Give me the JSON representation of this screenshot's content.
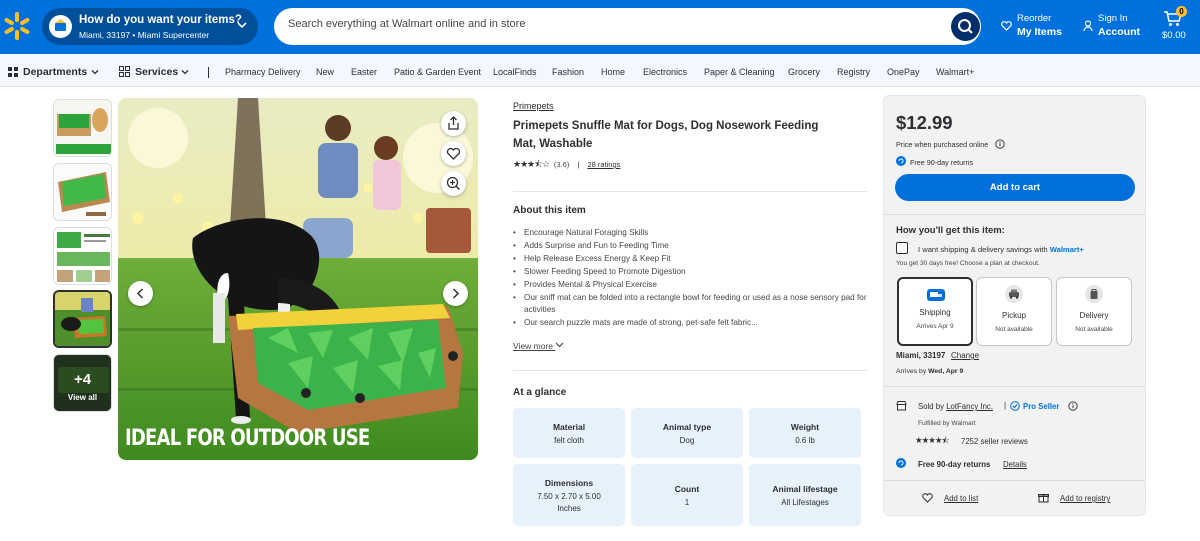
{
  "header": {
    "location_question": "How do you want your items?",
    "location_sub": "Miami, 33197 • Miami Supercenter",
    "search_placeholder": "Search everything at Walmart online and in store",
    "reorder_l1": "Reorder",
    "reorder_l2": "My Items",
    "signin_l1": "Sign In",
    "signin_l2": "Account",
    "cart_count": "0",
    "cart_total": "$0.00"
  },
  "nav": {
    "departments": "Departments",
    "services": "Services",
    "items": [
      "Pharmacy Delivery",
      "New",
      "Easter",
      "Patio & Garden Event",
      "LocalFinds",
      "Fashion",
      "Home",
      "Electronics",
      "Paper & Cleaning",
      "Grocery",
      "Registry",
      "OnePay",
      "Walmart+"
    ]
  },
  "gallery": {
    "more_count": "+4",
    "view_all": "View all",
    "caption": "IDEAL FOR OUTDOOR USE"
  },
  "product": {
    "brand": "Primepets",
    "title": "Primepets Snuffle Mat for Dogs, Dog Nosework Feeding Mat, Washable",
    "rating_value": 3.6,
    "rating_text": "(3.6)",
    "ratings_link": "28 ratings",
    "about_heading": "About this item",
    "bullets": [
      "Encourage Natural Foraging Skills",
      "Adds Surprise and Fun to Feeding Time",
      "Help Release Excess Energy & Keep Fit",
      "Slower Feeding Speed to Promote Digestion",
      "Provides Mental & Physical Exercise",
      "Our sniff mat can be folded into a rectangle bowl for feeding or used as a nose sensory pad for activities",
      "Our search puzzle mats are made of strong, pet-safe felt fabric..."
    ],
    "view_more": "View more",
    "glance_heading": "At a glance",
    "glance": [
      {
        "label": "Material",
        "value": "felt cloth"
      },
      {
        "label": "Animal type",
        "value": "Dog"
      },
      {
        "label": "Weight",
        "value": "0.6 lb"
      },
      {
        "label": "Dimensions",
        "value": "7.50 x 2.70 x 5.00 Inches"
      },
      {
        "label": "Count",
        "value": "1"
      },
      {
        "label": "Animal lifestage",
        "value": "All Lifestages"
      }
    ]
  },
  "buybox": {
    "price": "$12.99",
    "price_note": "Price when purchased online",
    "free_returns": "Free 90-day returns",
    "add_to_cart": "Add to cart",
    "get_heading": "How you'll get this item:",
    "walmart_plus_text": "I want shipping & delivery savings with",
    "walmart_plus_brand": "Walmart+",
    "trial_note": "You get 30 days free! Choose a plan at checkout.",
    "options": [
      {
        "label": "Shipping",
        "status": "Arrives Apr 9",
        "icon": "shipping-truck-icon"
      },
      {
        "label": "Pickup",
        "status": "Not available",
        "icon": "pickup-car-icon"
      },
      {
        "label": "Delivery",
        "status": "Not available",
        "icon": "delivery-bag-icon"
      }
    ],
    "location": "Miami, 33197",
    "change": "Change",
    "arrives_prefix": "Arrives by",
    "arrives_date": "Wed, Apr 9",
    "sold_by_prefix": "Sold by",
    "seller": "LotFancy Inc.",
    "pro_seller": "Pro Seller",
    "fulfilled": "Fulfilled by Walmart",
    "seller_rating": 4.5,
    "seller_reviews": "7252 seller reviews",
    "returns": "Free 90-day returns",
    "details": "Details",
    "add_to_list": "Add to list",
    "add_to_registry": "Add to registry"
  },
  "colors": {
    "brand_blue": "#0071dc",
    "spark_yellow": "#ffc220",
    "dark_blue": "#002e6b"
  }
}
